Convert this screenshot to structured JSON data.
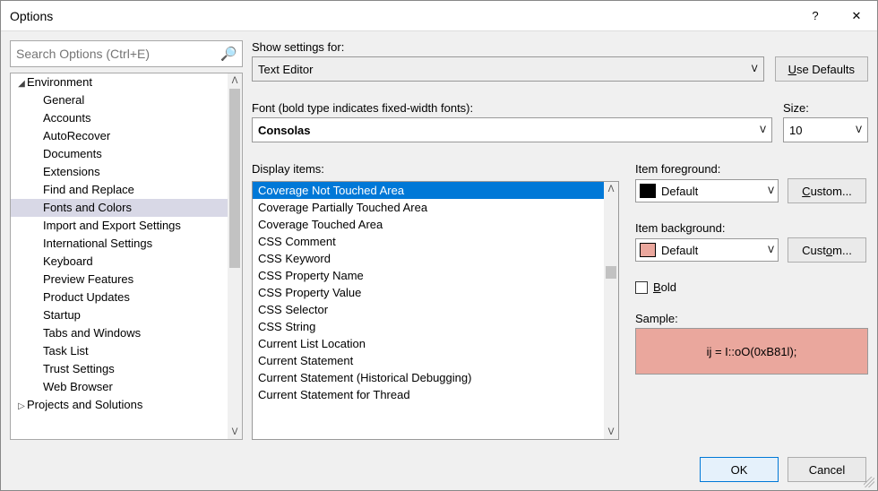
{
  "titlebar": {
    "title": "Options",
    "help": "?",
    "close": "✕"
  },
  "search": {
    "placeholder": "Search Options (Ctrl+E)"
  },
  "tree": {
    "nodes": [
      {
        "label": "Environment",
        "depth": 0,
        "expander": "◢",
        "selected": false
      },
      {
        "label": "General",
        "depth": 1,
        "expander": "",
        "selected": false
      },
      {
        "label": "Accounts",
        "depth": 1,
        "expander": "",
        "selected": false
      },
      {
        "label": "AutoRecover",
        "depth": 1,
        "expander": "",
        "selected": false
      },
      {
        "label": "Documents",
        "depth": 1,
        "expander": "",
        "selected": false
      },
      {
        "label": "Extensions",
        "depth": 1,
        "expander": "",
        "selected": false
      },
      {
        "label": "Find and Replace",
        "depth": 1,
        "expander": "",
        "selected": false
      },
      {
        "label": "Fonts and Colors",
        "depth": 1,
        "expander": "",
        "selected": true
      },
      {
        "label": "Import and Export Settings",
        "depth": 1,
        "expander": "",
        "selected": false
      },
      {
        "label": "International Settings",
        "depth": 1,
        "expander": "",
        "selected": false
      },
      {
        "label": "Keyboard",
        "depth": 1,
        "expander": "",
        "selected": false
      },
      {
        "label": "Preview Features",
        "depth": 1,
        "expander": "",
        "selected": false
      },
      {
        "label": "Product Updates",
        "depth": 1,
        "expander": "",
        "selected": false
      },
      {
        "label": "Startup",
        "depth": 1,
        "expander": "",
        "selected": false
      },
      {
        "label": "Tabs and Windows",
        "depth": 1,
        "expander": "",
        "selected": false
      },
      {
        "label": "Task List",
        "depth": 1,
        "expander": "",
        "selected": false
      },
      {
        "label": "Trust Settings",
        "depth": 1,
        "expander": "",
        "selected": false
      },
      {
        "label": "Web Browser",
        "depth": 1,
        "expander": "",
        "selected": false
      },
      {
        "label": "Projects and Solutions",
        "depth": 0,
        "expander": "▷",
        "selected": false
      }
    ]
  },
  "labels": {
    "show_settings": "Show settings for:",
    "use_defaults_pre": "",
    "use_defaults_u": "U",
    "use_defaults_post": "se Defaults",
    "font_label": "Font (bold type indicates fixed-width fonts):",
    "size_label": "Size:",
    "display_items": "Display items:",
    "item_fg": "Item foreground:",
    "item_bg": "Item background:",
    "custom_pre": "",
    "custom_u": "C",
    "custom_post": "ustom...",
    "custom2_pre": "Cust",
    "custom2_u": "o",
    "custom2_post": "m...",
    "bold_u": "B",
    "bold_post": "old",
    "sample": "Sample:",
    "ok": "OK",
    "cancel": "Cancel"
  },
  "values": {
    "show_settings": "Text Editor",
    "font": "Consolas",
    "size": "10",
    "fg_swatch": "#000000",
    "fg_name": "Default",
    "bg_swatch": "#eaa79d",
    "bg_name": "Default",
    "bold_checked": false,
    "sample_text": "ij = I::oO(0xB81l);",
    "sample_bg": "#eaa79d"
  },
  "display_items": [
    {
      "label": "Coverage Not Touched Area",
      "selected": true
    },
    {
      "label": "Coverage Partially Touched Area",
      "selected": false
    },
    {
      "label": "Coverage Touched Area",
      "selected": false
    },
    {
      "label": "CSS Comment",
      "selected": false
    },
    {
      "label": "CSS Keyword",
      "selected": false
    },
    {
      "label": "CSS Property Name",
      "selected": false
    },
    {
      "label": "CSS Property Value",
      "selected": false
    },
    {
      "label": "CSS Selector",
      "selected": false
    },
    {
      "label": "CSS String",
      "selected": false
    },
    {
      "label": "Current List Location",
      "selected": false
    },
    {
      "label": "Current Statement",
      "selected": false
    },
    {
      "label": "Current Statement (Historical Debugging)",
      "selected": false
    },
    {
      "label": "Current Statement for Thread",
      "selected": false
    }
  ]
}
